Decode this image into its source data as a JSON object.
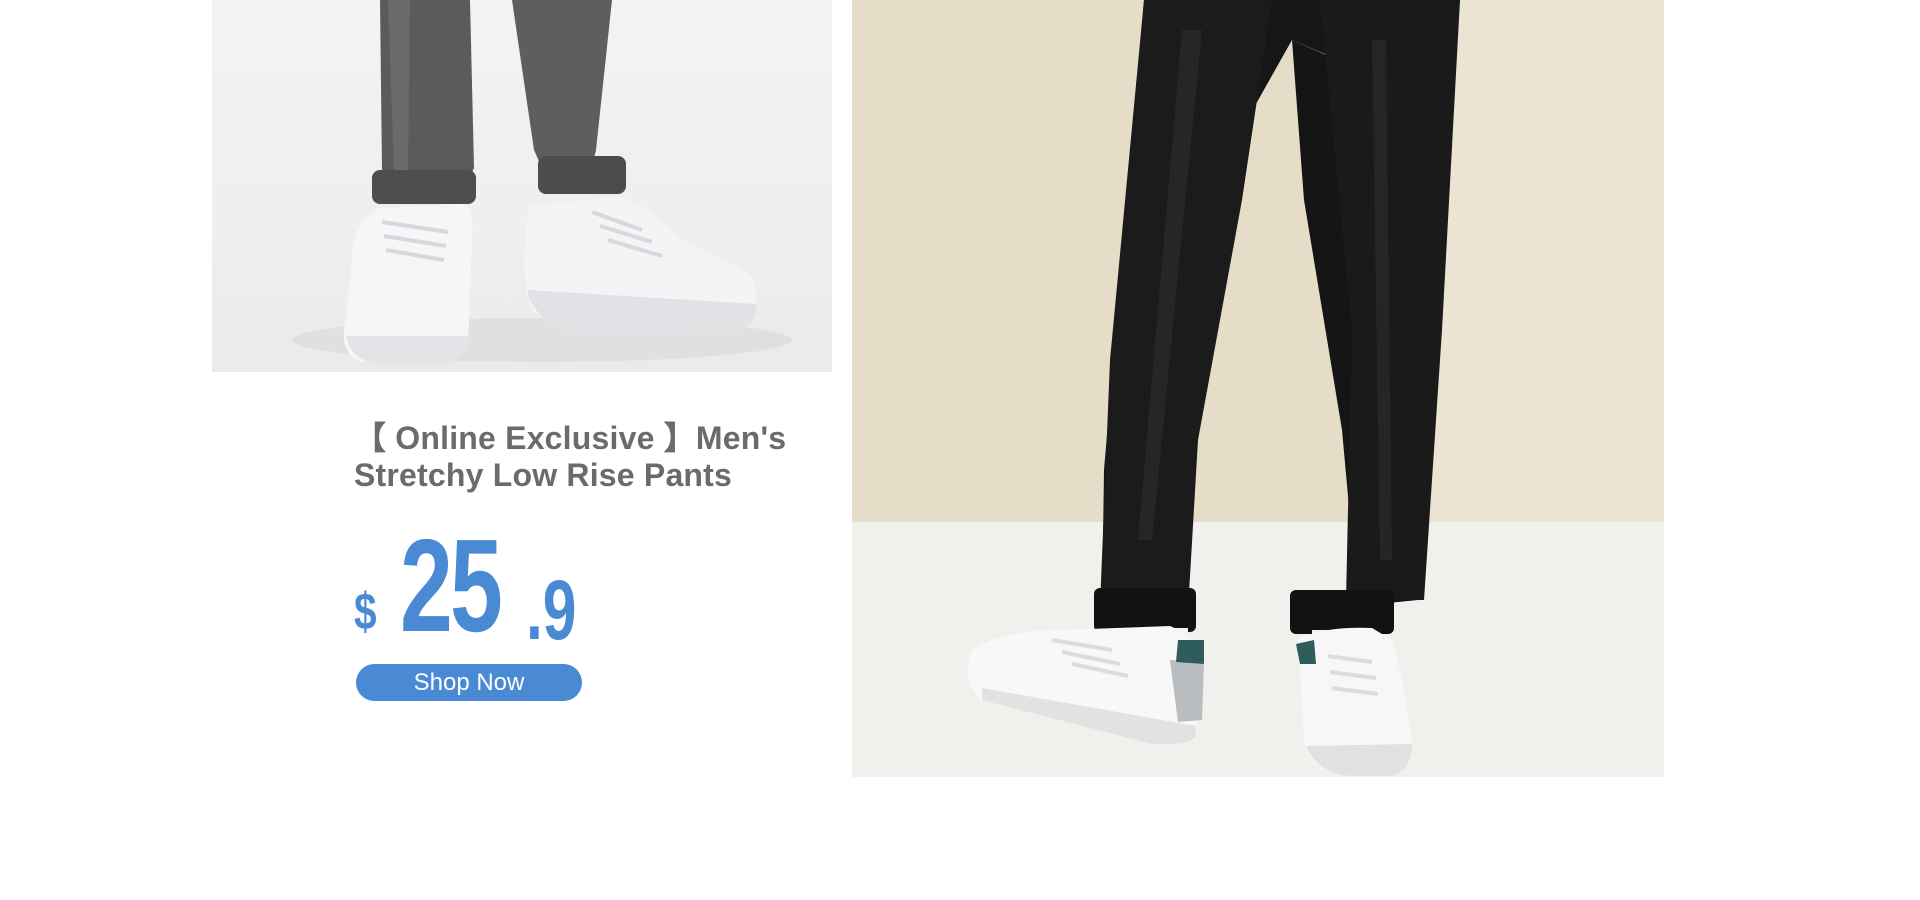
{
  "product": {
    "title_line1": "【 Online Exclusive 】Men's",
    "title_line2": "Stretchy Low Rise Pants",
    "price": {
      "currency": "$",
      "whole": "25",
      "decimal": ".9"
    },
    "cta_label": "Shop Now"
  },
  "images": {
    "left": "product-photo-grey-pants-white-sneakers",
    "right": "product-photo-black-pants-white-sneakers"
  },
  "colors": {
    "accent": "#4a8ad4",
    "title_text": "#6b6b6b",
    "button_text": "#ffffff",
    "background": "#ffffff"
  }
}
